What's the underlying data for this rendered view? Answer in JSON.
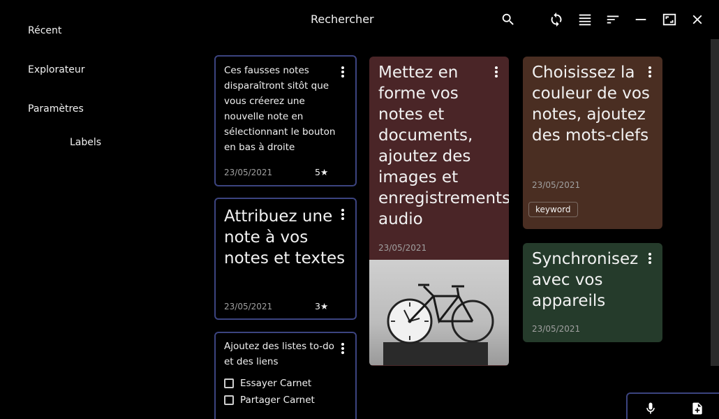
{
  "header": {
    "title": "Rechercher"
  },
  "toolbar": {
    "icons": [
      "search-icon",
      "sync-icon",
      "list-view-icon",
      "sort-icon",
      "minimize-icon",
      "maximize-icon",
      "close-icon"
    ]
  },
  "sidebar": {
    "items": [
      {
        "label": "Récent"
      },
      {
        "label": "Explorateur"
      },
      {
        "label": "Paramètres"
      },
      {
        "label": "Labels"
      }
    ]
  },
  "notes": [
    {
      "text": "Ces fausses notes disparaîtront sitôt que vous créerez une nouvelle note en sélectionnant le bouton en bas à droite",
      "date": "23/05/2021",
      "rating": "5★"
    },
    {
      "text": "Attribuez une note à vos notes et textes",
      "date": "23/05/2021",
      "rating": "3★"
    },
    {
      "text": "Ajoutez des listes to-do et des liens",
      "todos": [
        {
          "label": "Essayer Carnet",
          "checked": false
        },
        {
          "label": "Partager Carnet",
          "checked": false
        }
      ]
    },
    {
      "text": "Mettez en forme vos notes et documents, ajoutez des images et enregistrements audio",
      "date": "23/05/2021",
      "color": "#4a2527",
      "image": "clock-bicycle-photo"
    },
    {
      "text": "Choisissez la couleur de vos notes, ajoutez des mots-clefs",
      "date": "23/05/2021",
      "color": "#4a2e22",
      "keyword": "keyword"
    },
    {
      "text": "Synchronisez avec vos appareils",
      "date": "23/05/2021",
      "color": "#253b2b"
    }
  ],
  "fab": {
    "icons": [
      "microphone-icon",
      "new-note-icon"
    ]
  }
}
